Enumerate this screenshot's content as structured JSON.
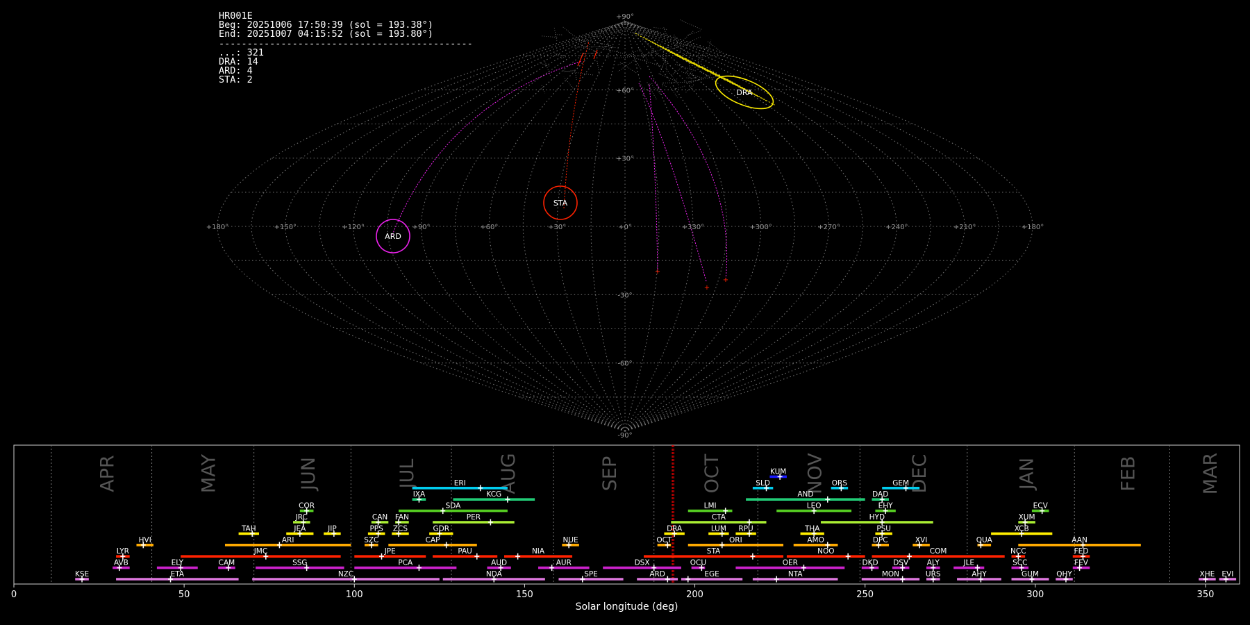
{
  "info": {
    "station": "HR001E",
    "beg": "Beg: 20251006 17:50:39 (sol = 193.38°)",
    "end": "End: 20251007 04:15:52 (sol = 193.80°)",
    "separator": "---------------------------------------------",
    "counts": [
      {
        "code": "...",
        "count": 321
      },
      {
        "code": "DRA",
        "count": 14
      },
      {
        "code": "ARD",
        "count": 4
      },
      {
        "code": "STA",
        "count": 2
      }
    ]
  },
  "colors": {
    "background": "#000000",
    "grid": "#8a8a8a",
    "sporadic": "#9a9a9a",
    "DRA": "#ffee00",
    "STA": "#ff2200",
    "ARD": "#ee22ee",
    "marker": "#ffffff",
    "current_sol_line": "#ff0000"
  },
  "chart_data": [
    {
      "type": "scatter",
      "projection": "sinusoidal (equal-area)",
      "x_ticks": [
        "+180°",
        "+150°",
        "+120°",
        "+90°",
        "+60°",
        "+30°",
        "+0°",
        "+330°",
        "+300°",
        "+270°",
        "+240°",
        "+210°",
        "+180°"
      ],
      "y_ticks": [
        "+90°",
        "+60°",
        "+30°",
        "-30°",
        "-60°",
        "-90°"
      ],
      "grid": true,
      "radiants": [
        {
          "name": "DRA",
          "lon": 314,
          "lat": 58,
          "color": "#ffee00"
        },
        {
          "name": "STA",
          "lon": 29,
          "lat": 7,
          "color": "#ff2200"
        },
        {
          "name": "ARD",
          "lon": 102,
          "lat": -3,
          "color": "#ee22ee"
        }
      ]
    },
    {
      "type": "timeline",
      "xlabel": "Solar longitude (deg)",
      "xlim": [
        0,
        360
      ],
      "x_ticks": [
        0,
        50,
        100,
        150,
        200,
        250,
        300,
        350
      ],
      "current_sol": [
        193.38,
        193.8
      ],
      "months": [
        {
          "name": "APR",
          "start": 11
        },
        {
          "name": "MAY",
          "start": 40.5
        },
        {
          "name": "JUN",
          "start": 70.5
        },
        {
          "name": "JUL",
          "start": 99
        },
        {
          "name": "AUG",
          "start": 128.5
        },
        {
          "name": "SEP",
          "start": 158.5
        },
        {
          "name": "OCT",
          "start": 188
        },
        {
          "name": "NOV",
          "start": 218.5
        },
        {
          "name": "DEC",
          "start": 248.5
        },
        {
          "name": "JAN",
          "start": 280
        },
        {
          "name": "FEB",
          "start": 311.5
        },
        {
          "name": "MAR",
          "start": 339.5
        }
      ],
      "showers": [
        {
          "code": "KUM",
          "start": 222,
          "end": 227,
          "peak": 225,
          "row": 9,
          "color": "#1a1aff"
        },
        {
          "code": "ERI",
          "start": 117,
          "end": 145,
          "peak": 137,
          "row": 8,
          "color": "#00ccee"
        },
        {
          "code": "SLD",
          "start": 217,
          "end": 223,
          "peak": 221,
          "row": 8,
          "color": "#00ccee"
        },
        {
          "code": "ORS",
          "start": 240,
          "end": 245,
          "peak": 243,
          "row": 8,
          "color": "#00ccee"
        },
        {
          "code": "GEM",
          "start": 255,
          "end": 266,
          "peak": 262,
          "row": 8,
          "color": "#00ccee"
        },
        {
          "code": "IXA",
          "start": 117,
          "end": 121,
          "peak": 119,
          "row": 7,
          "color": "#22cc77"
        },
        {
          "code": "KCG",
          "start": 129,
          "end": 153,
          "peak": 145,
          "row": 7,
          "color": "#22cc77"
        },
        {
          "code": "AND",
          "start": 215,
          "end": 250,
          "peak": 239,
          "row": 7,
          "color": "#22cc77"
        },
        {
          "code": "DAD",
          "start": 252,
          "end": 257,
          "peak": 255,
          "row": 7,
          "color": "#22cc77"
        },
        {
          "code": "COR",
          "start": 84,
          "end": 88,
          "peak": 86,
          "row": 6,
          "color": "#55cc22"
        },
        {
          "code": "SDA",
          "start": 113,
          "end": 145,
          "peak": 126,
          "row": 6,
          "color": "#55cc22"
        },
        {
          "code": "LMI",
          "start": 198,
          "end": 211,
          "peak": 209,
          "row": 6,
          "color": "#55cc22"
        },
        {
          "code": "LEO",
          "start": 224,
          "end": 246,
          "peak": 235,
          "row": 6,
          "color": "#55cc22"
        },
        {
          "code": "EHY",
          "start": 253,
          "end": 259,
          "peak": 256,
          "row": 6,
          "color": "#55cc22"
        },
        {
          "code": "ECV",
          "start": 299,
          "end": 304,
          "peak": 302,
          "row": 6,
          "color": "#55cc22"
        },
        {
          "code": "JRC",
          "start": 82,
          "end": 87,
          "peak": 85,
          "row": 5,
          "color": "#aaee33"
        },
        {
          "code": "CAN",
          "start": 105,
          "end": 110,
          "peak": 107,
          "row": 5,
          "color": "#aaee33"
        },
        {
          "code": "FAN",
          "start": 112,
          "end": 116,
          "peak": 113,
          "row": 5,
          "color": "#aaee33"
        },
        {
          "code": "PER",
          "start": 123,
          "end": 147,
          "peak": 140,
          "row": 5,
          "color": "#aaee33"
        },
        {
          "code": "CTA",
          "start": 193,
          "end": 221,
          "peak": 216,
          "row": 5,
          "color": "#aaee33"
        },
        {
          "code": "HYD",
          "start": 237,
          "end": 270,
          "peak": 255,
          "row": 5,
          "color": "#aaee33"
        },
        {
          "code": "XUM",
          "start": 295,
          "end": 300,
          "peak": 297,
          "row": 5,
          "color": "#aaee33"
        },
        {
          "code": "TAH",
          "start": 66,
          "end": 72,
          "peak": 70,
          "row": 4,
          "color": "#ffee00"
        },
        {
          "code": "JEA",
          "start": 80,
          "end": 88,
          "peak": 84,
          "row": 4,
          "color": "#ffee00"
        },
        {
          "code": "JIP",
          "start": 91,
          "end": 96,
          "peak": 94,
          "row": 4,
          "color": "#ffee00"
        },
        {
          "code": "PPS",
          "start": 104,
          "end": 109,
          "peak": 107,
          "row": 4,
          "color": "#ffee00"
        },
        {
          "code": "ZCS",
          "start": 111,
          "end": 116,
          "peak": 113,
          "row": 4,
          "color": "#ffee00"
        },
        {
          "code": "GDR",
          "start": 122,
          "end": 129,
          "peak": 125,
          "row": 4,
          "color": "#ffee00"
        },
        {
          "code": "DRA",
          "start": 191,
          "end": 197,
          "peak": 194,
          "row": 4,
          "color": "#ffee00"
        },
        {
          "code": "LUM",
          "start": 204,
          "end": 210,
          "peak": 208,
          "row": 4,
          "color": "#ffee00"
        },
        {
          "code": "RPU",
          "start": 212,
          "end": 218,
          "peak": 216,
          "row": 4,
          "color": "#ffee00"
        },
        {
          "code": "THA",
          "start": 231,
          "end": 238,
          "peak": 235,
          "row": 4,
          "color": "#ffee00"
        },
        {
          "code": "PSU",
          "start": 253,
          "end": 258,
          "peak": 255,
          "row": 4,
          "color": "#ffee00"
        },
        {
          "code": "XCB",
          "start": 287,
          "end": 305,
          "peak": 296,
          "row": 4,
          "color": "#ffee00"
        },
        {
          "code": "HVI",
          "start": 36,
          "end": 41,
          "peak": 38,
          "row": 3,
          "color": "#ffaa00"
        },
        {
          "code": "ARI",
          "start": 62,
          "end": 99,
          "peak": 78,
          "row": 3,
          "color": "#ffaa00"
        },
        {
          "code": "SZC",
          "start": 103,
          "end": 107,
          "peak": 105,
          "row": 3,
          "color": "#ffaa00"
        },
        {
          "code": "CAP",
          "start": 110,
          "end": 136,
          "peak": 127,
          "row": 3,
          "color": "#ffaa00"
        },
        {
          "code": "NUE",
          "start": 161,
          "end": 166,
          "peak": 163,
          "row": 3,
          "color": "#ffaa00"
        },
        {
          "code": "OCT",
          "start": 189,
          "end": 193,
          "peak": 192,
          "row": 3,
          "color": "#ffaa00"
        },
        {
          "code": "ORI",
          "start": 198,
          "end": 226,
          "peak": 208,
          "row": 3,
          "color": "#ffaa00"
        },
        {
          "code": "AMO",
          "start": 229,
          "end": 242,
          "peak": 239,
          "row": 3,
          "color": "#ffaa00"
        },
        {
          "code": "DPC",
          "start": 252,
          "end": 257,
          "peak": 254,
          "row": 3,
          "color": "#ffaa00"
        },
        {
          "code": "XVI",
          "start": 264,
          "end": 269,
          "peak": 266,
          "row": 3,
          "color": "#ffaa00"
        },
        {
          "code": "QUA",
          "start": 283,
          "end": 287,
          "peak": 284,
          "row": 3,
          "color": "#ffaa00"
        },
        {
          "code": "AAN",
          "start": 295,
          "end": 331,
          "peak": 314,
          "row": 3,
          "color": "#ffaa00"
        },
        {
          "code": "LYR",
          "start": 30,
          "end": 34,
          "peak": 32,
          "row": 2,
          "color": "#ff2200"
        },
        {
          "code": "JMC",
          "start": 49,
          "end": 96,
          "peak": 74,
          "row": 2,
          "color": "#ff2200"
        },
        {
          "code": "JPE",
          "start": 100,
          "end": 121,
          "peak": 108,
          "row": 2,
          "color": "#ff2200"
        },
        {
          "code": "PAU",
          "start": 123,
          "end": 142,
          "peak": 136,
          "row": 2,
          "color": "#ff2200"
        },
        {
          "code": "NIA",
          "start": 144,
          "end": 164,
          "peak": 148,
          "row": 2,
          "color": "#ff2200"
        },
        {
          "code": "STA",
          "start": 185,
          "end": 226,
          "peak": 217,
          "row": 2,
          "color": "#ff2200"
        },
        {
          "code": "NOO",
          "start": 227,
          "end": 250,
          "peak": 245,
          "row": 2,
          "color": "#ff2200"
        },
        {
          "code": "COM",
          "start": 252,
          "end": 291,
          "peak": 263,
          "row": 2,
          "color": "#ff2200"
        },
        {
          "code": "NCC",
          "start": 293,
          "end": 297,
          "peak": 295,
          "row": 2,
          "color": "#ff2200"
        },
        {
          "code": "FED",
          "start": 311,
          "end": 316,
          "peak": 314,
          "row": 2,
          "color": "#ff2200"
        },
        {
          "code": "AVB",
          "start": 29,
          "end": 34,
          "peak": 31,
          "row": 1,
          "color": "#cc22cc"
        },
        {
          "code": "ELY",
          "start": 42,
          "end": 54,
          "peak": 49,
          "row": 1,
          "color": "#cc22cc"
        },
        {
          "code": "CAM",
          "start": 60,
          "end": 65,
          "peak": 63,
          "row": 1,
          "color": "#cc22cc"
        },
        {
          "code": "SSG",
          "start": 71,
          "end": 97,
          "peak": 86,
          "row": 1,
          "color": "#cc22cc"
        },
        {
          "code": "PCA",
          "start": 100,
          "end": 130,
          "peak": 119,
          "row": 1,
          "color": "#cc22cc"
        },
        {
          "code": "AUD",
          "start": 139,
          "end": 146,
          "peak": 143,
          "row": 1,
          "color": "#cc22cc"
        },
        {
          "code": "AUR",
          "start": 154,
          "end": 169,
          "peak": 158,
          "row": 1,
          "color": "#cc22cc"
        },
        {
          "code": "DSX",
          "start": 173,
          "end": 196,
          "peak": 188,
          "row": 1,
          "color": "#cc22cc"
        },
        {
          "code": "OCU",
          "start": 199,
          "end": 203,
          "peak": 202,
          "row": 1,
          "color": "#cc22cc"
        },
        {
          "code": "OER",
          "start": 212,
          "end": 244,
          "peak": 232,
          "row": 1,
          "color": "#cc22cc"
        },
        {
          "code": "DKD",
          "start": 249,
          "end": 254,
          "peak": 252,
          "row": 1,
          "color": "#cc22cc"
        },
        {
          "code": "DSV",
          "start": 258,
          "end": 263,
          "peak": 261,
          "row": 1,
          "color": "#cc22cc"
        },
        {
          "code": "ALY",
          "start": 268,
          "end": 272,
          "peak": 270,
          "row": 1,
          "color": "#cc22cc"
        },
        {
          "code": "JLE",
          "start": 276,
          "end": 285,
          "peak": 283,
          "row": 1,
          "color": "#cc22cc"
        },
        {
          "code": "SCC",
          "start": 293,
          "end": 298,
          "peak": 296,
          "row": 1,
          "color": "#cc22cc"
        },
        {
          "code": "FEV",
          "start": 311,
          "end": 316,
          "peak": 313,
          "row": 1,
          "color": "#cc22cc"
        },
        {
          "code": "KSE",
          "start": 18,
          "end": 22,
          "peak": 20,
          "row": 0,
          "color": "#dd77dd"
        },
        {
          "code": "ETA",
          "start": 30,
          "end": 66,
          "peak": 46,
          "row": 0,
          "color": "#dd77dd"
        },
        {
          "code": "NZC",
          "start": 70,
          "end": 125,
          "peak": 100,
          "row": 0,
          "color": "#dd77dd"
        },
        {
          "code": "NDA",
          "start": 126,
          "end": 156,
          "peak": 141,
          "row": 0,
          "color": "#dd77dd"
        },
        {
          "code": "SPE",
          "start": 160,
          "end": 179,
          "peak": 167,
          "row": 0,
          "color": "#dd77dd"
        },
        {
          "code": "ARD",
          "start": 183,
          "end": 195,
          "peak": 192,
          "row": 0,
          "color": "#dd77dd"
        },
        {
          "code": "EGE",
          "start": 196,
          "end": 214,
          "peak": 198,
          "row": 0,
          "color": "#dd77dd"
        },
        {
          "code": "NTA",
          "start": 217,
          "end": 242,
          "peak": 224,
          "row": 0,
          "color": "#dd77dd"
        },
        {
          "code": "MON",
          "start": 249,
          "end": 266,
          "peak": 261,
          "row": 0,
          "color": "#dd77dd"
        },
        {
          "code": "URS",
          "start": 268,
          "end": 272,
          "peak": 270,
          "row": 0,
          "color": "#dd77dd"
        },
        {
          "code": "AHY",
          "start": 277,
          "end": 290,
          "peak": 284,
          "row": 0,
          "color": "#dd77dd"
        },
        {
          "code": "GUM",
          "start": 293,
          "end": 304,
          "peak": 299,
          "row": 0,
          "color": "#dd77dd"
        },
        {
          "code": "QHY",
          "start": 306,
          "end": 311,
          "peak": 309,
          "row": 0,
          "color": "#dd77dd"
        },
        {
          "code": "XHE",
          "start": 348,
          "end": 353,
          "peak": 350,
          "row": 0,
          "color": "#dd77dd"
        },
        {
          "code": "EVI",
          "start": 354,
          "end": 359,
          "peak": 356,
          "row": 0,
          "color": "#dd77dd"
        }
      ]
    }
  ]
}
